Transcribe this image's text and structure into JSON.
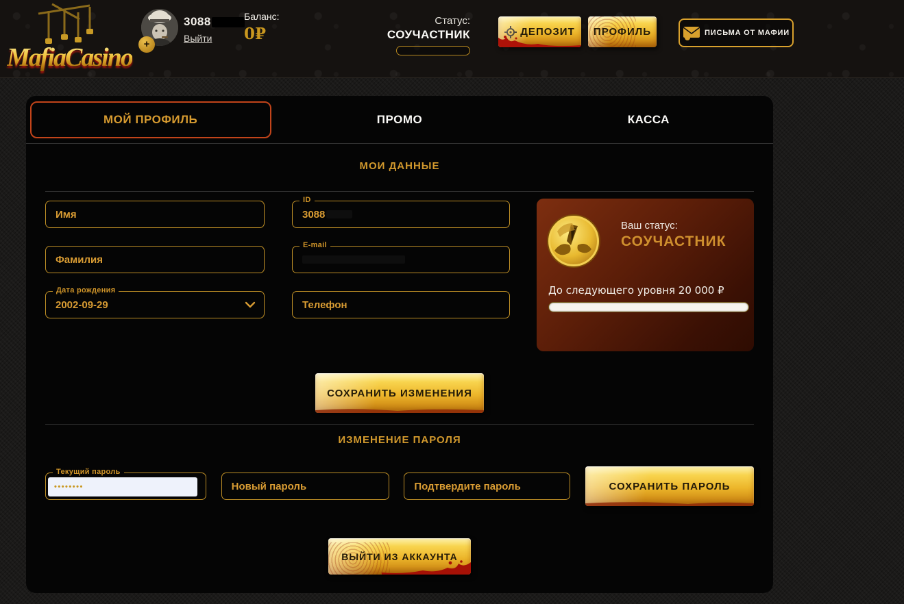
{
  "header": {
    "logo": {
      "part1": "Mafia",
      "part2": "Casino"
    },
    "user": {
      "id": "3088",
      "logout_label": "Выйти",
      "avatar_plus": "+"
    },
    "balance": {
      "label": "Баланс:",
      "value": "0₽"
    },
    "status": {
      "label": "Статус:",
      "value": "СОУЧАСТНИК"
    },
    "buttons": {
      "deposit": "ДЕПОЗИТ",
      "profile": "ПРОФИЛЬ",
      "letters": "ПИСЬМА ОТ МАФИИ"
    }
  },
  "tabs": {
    "my_profile": "МОЙ ПРОФИЛЬ",
    "promo": "ПРОМО",
    "cashier": "КАССА"
  },
  "profile_section": {
    "title": "МОИ ДАННЫЕ",
    "fields": {
      "first_name_placeholder": "Имя",
      "id_label": "ID",
      "id_value": "3088",
      "last_name_placeholder": "Фамилия",
      "email_label": "E-mail",
      "birthdate_label": "Дата рождения",
      "birthdate_value": "2002-09-29",
      "phone_placeholder": "Телефон"
    },
    "status_card": {
      "label": "Ваш статус:",
      "value": "СОУЧАСТНИК",
      "next_level_text": "До следующего уровня 20 000 ₽"
    },
    "save_button": "СОХРАНИТЬ ИЗМЕНЕНИЯ"
  },
  "password_section": {
    "title": "ИЗМЕНЕНИЕ ПАРОЛЯ",
    "current_label": "Текущий пароль",
    "current_value": "••••••••",
    "new_placeholder": "Новый пароль",
    "confirm_placeholder": "Подтвердите пароль",
    "save_button": "СОХРАНИТЬ ПАРОЛЬ"
  },
  "logout_button": "ВЫЙТИ ИЗ АККАУНТА",
  "colors": {
    "accent_gold": "#d99c33",
    "field_border_gold": "#bf8f26",
    "active_tab_border": "#c2441a",
    "button_gold": "#ecb52a",
    "card_maroon": "#5a1d08",
    "panel_black": "#050505",
    "balance_gold": "#c9971f",
    "blood_red": "#b51208"
  }
}
